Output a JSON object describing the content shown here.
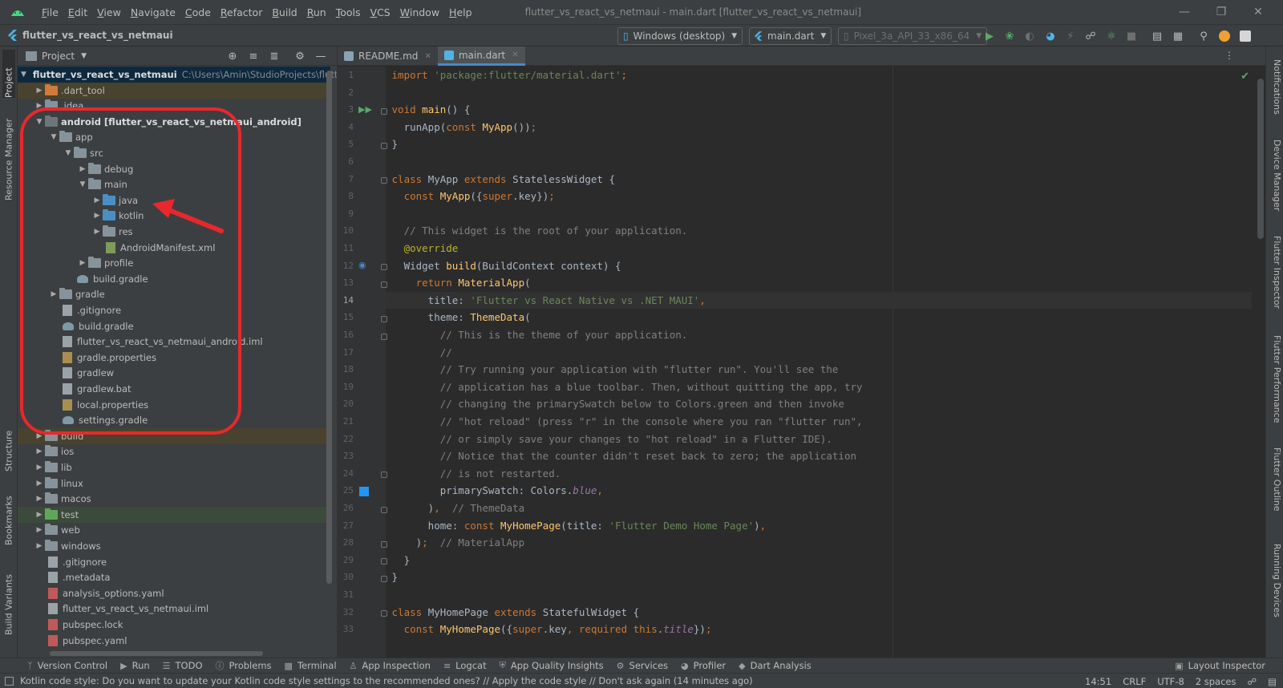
{
  "menubar": {
    "items": [
      "File",
      "Edit",
      "View",
      "Navigate",
      "Code",
      "Refactor",
      "Build",
      "Run",
      "Tools",
      "VCS",
      "Window",
      "Help"
    ],
    "window_title": "flutter_vs_react_vs_netmaui - main.dart [flutter_vs_react_vs_netmaui]"
  },
  "navbar": {
    "project_name": "flutter_vs_react_vs_netmaui",
    "device_target": "Windows (desktop)",
    "run_config": "main.dart",
    "emulator": "Pixel_3a_API_33_x86_64"
  },
  "left_stripe": {
    "tabs": [
      "Project",
      "Resource Manager",
      "Structure",
      "Bookmarks",
      "Build Variants"
    ]
  },
  "right_stripe": {
    "tabs": [
      "Notifications",
      "Device Manager",
      "Flutter Inspector",
      "Flutter Performance",
      "Flutter Outline",
      "Running Devices"
    ]
  },
  "project_panel": {
    "title": "Project",
    "tree": [
      {
        "label": "flutter_vs_react_vs_netmaui",
        "path": "C:\\Users\\Amin\\StudioProjects\\flutter"
      },
      {
        "label": ".dart_tool"
      },
      {
        "label": ".idea"
      },
      {
        "label": "android [flutter_vs_react_vs_netmaui_android]"
      },
      {
        "label": "app"
      },
      {
        "label": "src"
      },
      {
        "label": "debug"
      },
      {
        "label": "main"
      },
      {
        "label": "java"
      },
      {
        "label": "kotlin"
      },
      {
        "label": "res"
      },
      {
        "label": "AndroidManifest.xml"
      },
      {
        "label": "profile"
      },
      {
        "label": "build.gradle"
      },
      {
        "label": "gradle"
      },
      {
        "label": ".gitignore"
      },
      {
        "label": "build.gradle"
      },
      {
        "label": "flutter_vs_react_vs_netmaui_android.iml"
      },
      {
        "label": "gradle.properties"
      },
      {
        "label": "gradlew"
      },
      {
        "label": "gradlew.bat"
      },
      {
        "label": "local.properties"
      },
      {
        "label": "settings.gradle"
      },
      {
        "label": "build"
      },
      {
        "label": "ios"
      },
      {
        "label": "lib"
      },
      {
        "label": "linux"
      },
      {
        "label": "macos"
      },
      {
        "label": "test"
      },
      {
        "label": "web"
      },
      {
        "label": "windows"
      },
      {
        "label": ".gitignore"
      },
      {
        "label": ".metadata"
      },
      {
        "label": "analysis_options.yaml"
      },
      {
        "label": "flutter_vs_react_vs_netmaui.iml"
      },
      {
        "label": "pubspec.lock"
      },
      {
        "label": "pubspec.yaml"
      }
    ]
  },
  "editor": {
    "tabs": [
      {
        "label": "README.md",
        "active": false
      },
      {
        "label": "main.dart",
        "active": true
      }
    ],
    "current_line": 14,
    "line_numbers": [
      "1",
      "2",
      "3",
      "4",
      "5",
      "6",
      "7",
      "8",
      "9",
      "10",
      "11",
      "12",
      "13",
      "14",
      "15",
      "16",
      "17",
      "18",
      "19",
      "20",
      "21",
      "22",
      "23",
      "24",
      "25",
      "26",
      "27",
      "28",
      "29",
      "30",
      "31",
      "32",
      "33"
    ]
  },
  "bottom_toolbar": {
    "items": [
      {
        "label": "Version Control",
        "icon": "branch-icon"
      },
      {
        "label": "Run",
        "icon": "play-icon"
      },
      {
        "label": "TODO",
        "icon": "list-icon"
      },
      {
        "label": "Problems",
        "icon": "warning-icon"
      },
      {
        "label": "Terminal",
        "icon": "terminal-icon"
      },
      {
        "label": "App Inspection",
        "icon": "inspect-icon"
      },
      {
        "label": "Logcat",
        "icon": "logcat-icon"
      },
      {
        "label": "App Quality Insights",
        "icon": "shield-icon"
      },
      {
        "label": "Services",
        "icon": "services-icon"
      },
      {
        "label": "Profiler",
        "icon": "gauge-icon"
      },
      {
        "label": "Dart Analysis",
        "icon": "dart-icon"
      }
    ],
    "layout_inspector": "Layout Inspector"
  },
  "statusbar": {
    "message": "Kotlin code style: Do you want to update your Kotlin code style settings to the recommended ones? // Apply the code style // Don't ask again (14 minutes ago)",
    "position": "14:51",
    "line_separator": "CRLF",
    "encoding": "UTF-8",
    "indent": "2 spaces"
  },
  "colors": {
    "annotation_red": "#e8282c",
    "accent_blue": "#4a88c7",
    "run_green": "#59a869"
  }
}
